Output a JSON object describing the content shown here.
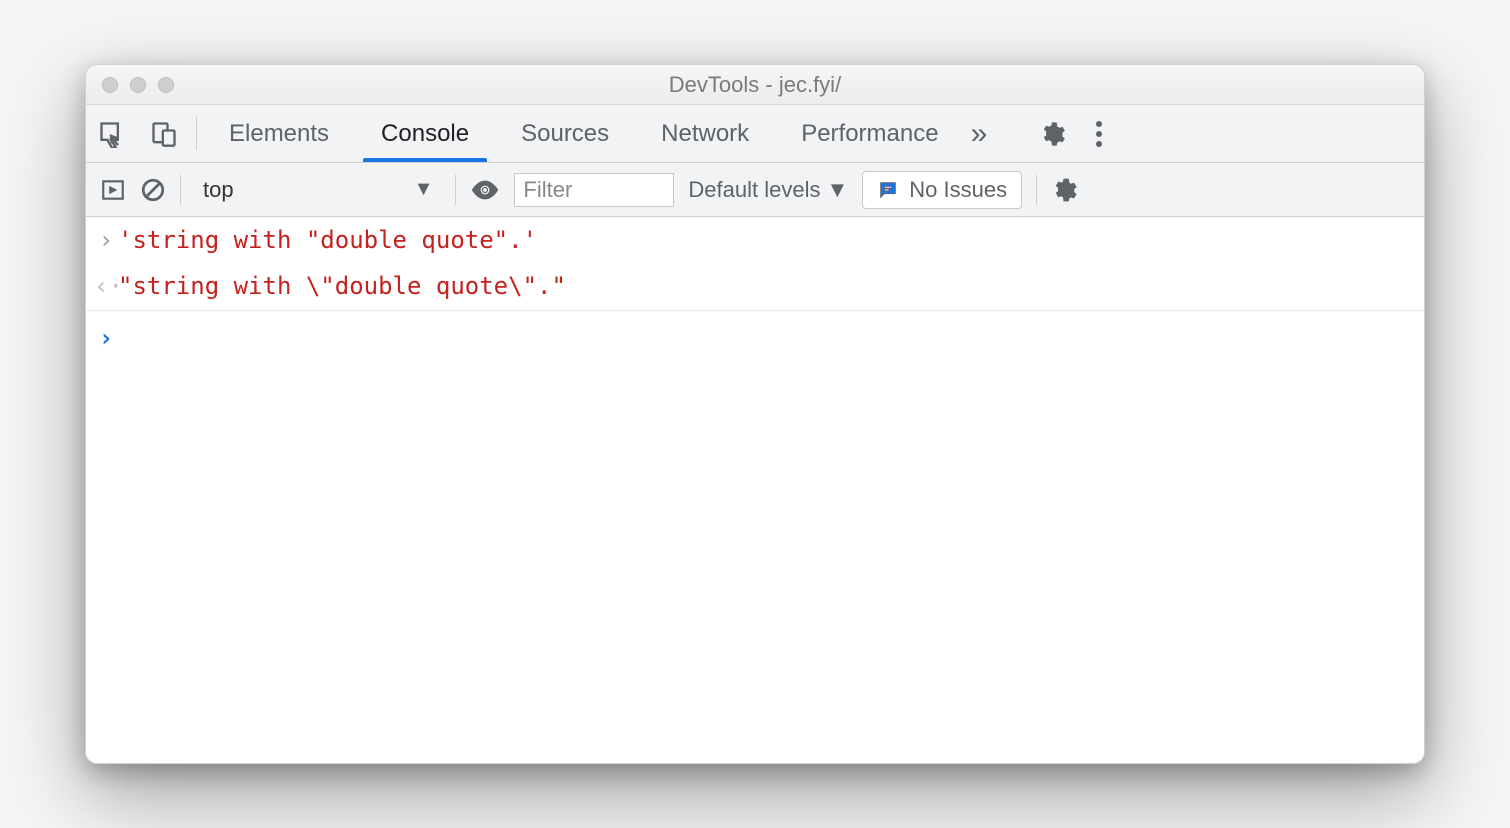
{
  "window": {
    "title": "DevTools - jec.fyi/"
  },
  "tabs": {
    "items": [
      "Elements",
      "Console",
      "Sources",
      "Network",
      "Performance"
    ],
    "active": "Console",
    "overflow_glyph": "»"
  },
  "toolbar": {
    "context": "top",
    "filter_placeholder": "Filter",
    "levels_label": "Default levels",
    "issues_label": "No Issues"
  },
  "console": {
    "input_cue": "›",
    "output_cue": "‹·",
    "prompt_cue": "›",
    "rows": [
      {
        "kind": "input",
        "text": "'string with \"double quote\".'"
      },
      {
        "kind": "output",
        "text": "\"string with \\\"double quote\\\".\""
      }
    ]
  }
}
